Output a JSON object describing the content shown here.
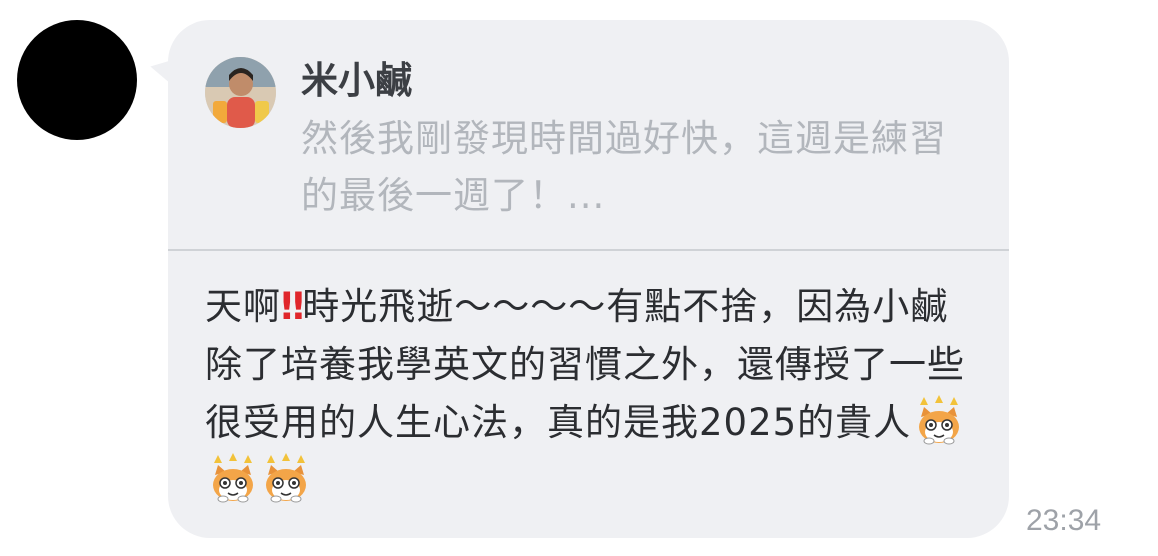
{
  "chat": {
    "sender_avatar_icon": "blacked-out-avatar",
    "reply_quote": {
      "author_avatar_icon": "user-photo-avatar",
      "author": "米小鹹",
      "text": "然後我剛發現時間過好快，這週是練習的最後一週了！..."
    },
    "message": {
      "part1": "天啊",
      "emphasis": "‼",
      "part2": "時光飛逝～～～～有點不捨，因為小鹹除了培養我學英文的習慣之外，還傳授了一些很受用的人生心法，真的是我2025的貴人",
      "stickers": [
        "cat-sticker",
        "cat-sticker",
        "cat-sticker"
      ]
    },
    "timestamp": "23:34"
  },
  "colors": {
    "bubble_bg": "#eff0f3",
    "quote_text": "#b2b6bc",
    "message_text": "#2b2d31",
    "emphasis": "#e0262b",
    "timestamp": "#9ea2a8"
  }
}
